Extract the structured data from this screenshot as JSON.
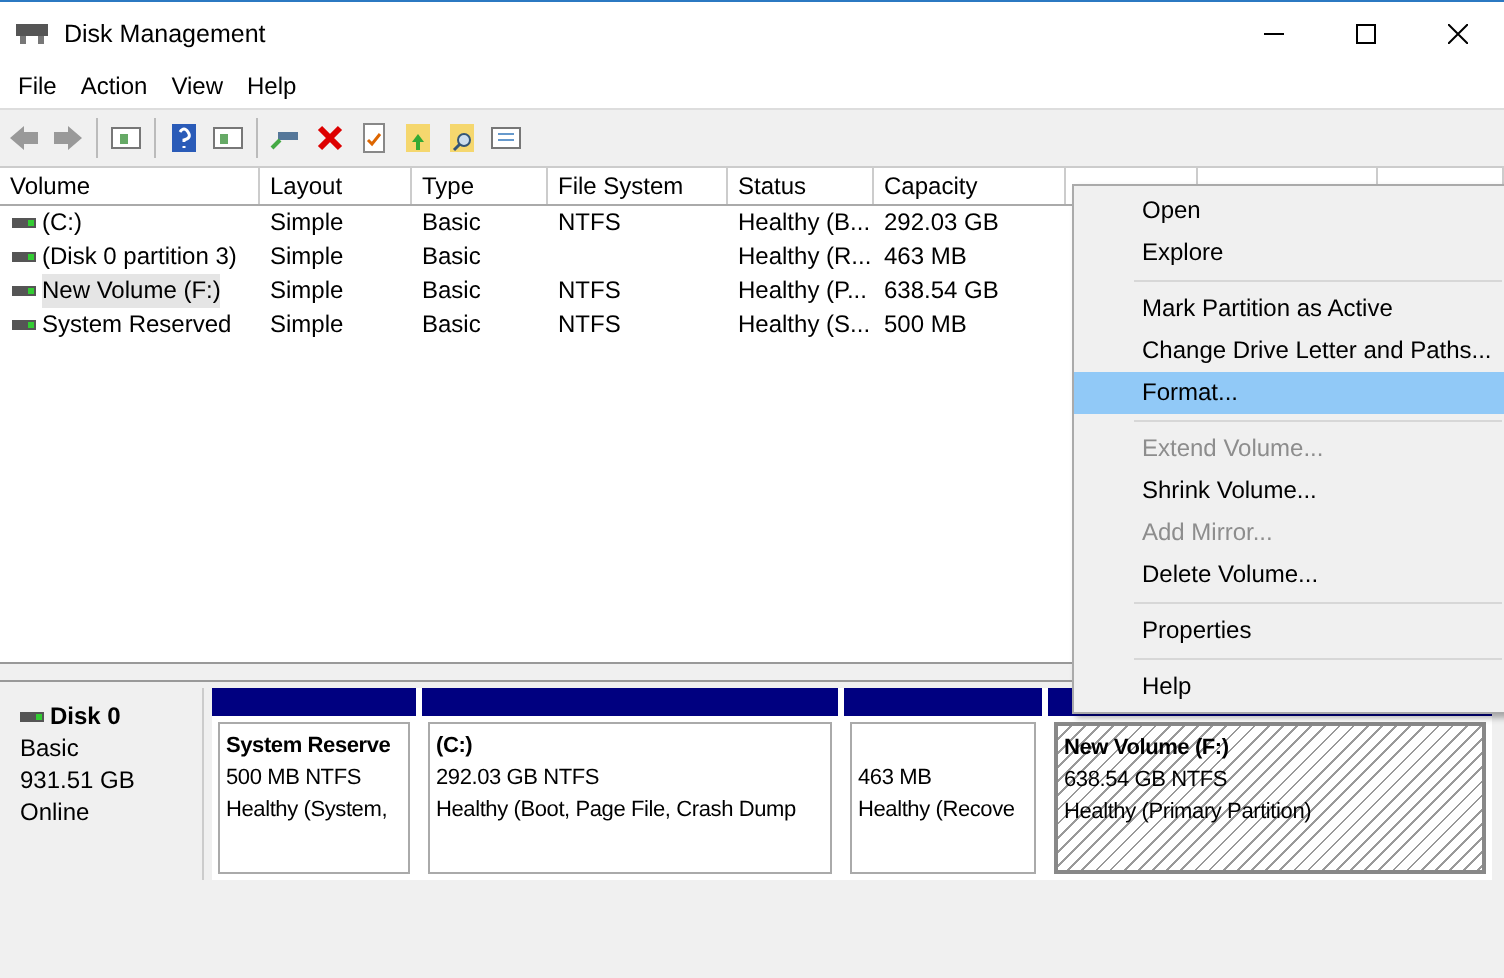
{
  "window": {
    "title": "Disk Management"
  },
  "menu_bar": [
    "File",
    "Action",
    "View",
    "Help"
  ],
  "table": {
    "columns": [
      "Volume",
      "Layout",
      "Type",
      "File System",
      "Status",
      "Capacity"
    ],
    "rows": [
      {
        "selected": false,
        "cells": [
          "(C:)",
          "Simple",
          "Basic",
          "NTFS",
          "Healthy (B...",
          "292.03 GB"
        ]
      },
      {
        "selected": false,
        "cells": [
          "(Disk 0 partition 3)",
          "Simple",
          "Basic",
          "",
          "Healthy (R...",
          "463 MB"
        ]
      },
      {
        "selected": true,
        "cells": [
          "New Volume (F:)",
          "Simple",
          "Basic",
          "NTFS",
          "Healthy (P...",
          "638.54 GB"
        ]
      },
      {
        "selected": false,
        "cells": [
          "System Reserved",
          "Simple",
          "Basic",
          "NTFS",
          "Healthy (S...",
          "500 MB"
        ]
      }
    ]
  },
  "disk": {
    "name": "Disk 0",
    "type": "Basic",
    "size": "931.51 GB",
    "status": "Online",
    "partitions": [
      {
        "name": "System Reserve",
        "info": "500 MB NTFS",
        "status": "Healthy (System,",
        "selected": false
      },
      {
        "name": "(C:)",
        "info": "292.03 GB NTFS",
        "status": "Healthy (Boot, Page File, Crash Dump",
        "selected": false
      },
      {
        "info": "463 MB",
        "status": "Healthy (Recove",
        "selected": false
      },
      {
        "name": "New Volume  (F:)",
        "info": "638.54 GB NTFS",
        "status": "Healthy (Primary Partition)",
        "selected": true
      }
    ]
  },
  "context_menu": [
    {
      "kind": "item",
      "label": "Open",
      "disabled": false,
      "selected": false
    },
    {
      "kind": "item",
      "label": "Explore",
      "disabled": false,
      "selected": false
    },
    {
      "kind": "separator"
    },
    {
      "kind": "item",
      "label": "Mark Partition as Active",
      "disabled": false,
      "selected": false
    },
    {
      "kind": "item",
      "label": "Change Drive Letter and Paths...",
      "disabled": false,
      "selected": false
    },
    {
      "kind": "item",
      "label": "Format...",
      "disabled": false,
      "selected": true
    },
    {
      "kind": "separator"
    },
    {
      "kind": "item",
      "label": "Extend Volume...",
      "disabled": true,
      "selected": false
    },
    {
      "kind": "item",
      "label": "Shrink Volume...",
      "disabled": false,
      "selected": false
    },
    {
      "kind": "item",
      "label": "Add Mirror...",
      "disabled": true,
      "selected": false
    },
    {
      "kind": "item",
      "label": "Delete Volume...",
      "disabled": false,
      "selected": false
    },
    {
      "kind": "separator"
    },
    {
      "kind": "item",
      "label": "Properties",
      "disabled": false,
      "selected": false
    },
    {
      "kind": "separator"
    },
    {
      "kind": "item",
      "label": "Help",
      "disabled": false,
      "selected": false
    }
  ]
}
